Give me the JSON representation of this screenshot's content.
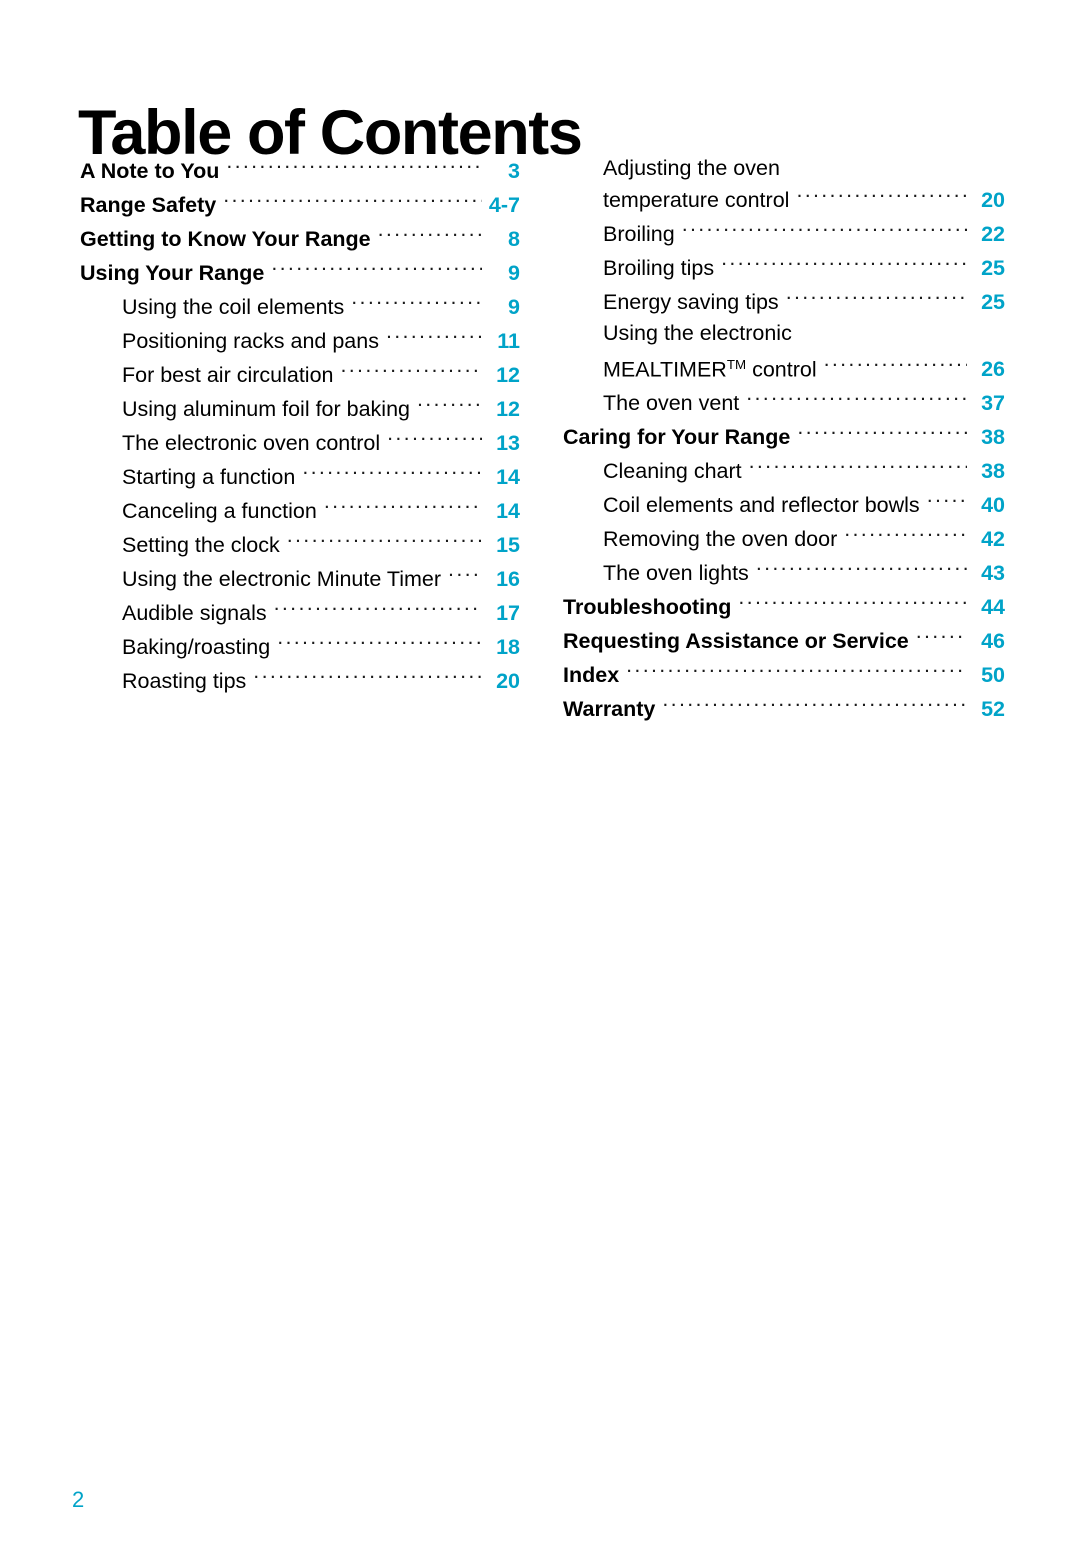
{
  "document": {
    "title": "Table of Contents",
    "folio": "2",
    "accent_color": "#00a3c8",
    "text_color": "#000000",
    "background_color": "#ffffff"
  },
  "toc": {
    "left_column": [
      {
        "label": "A Note to You",
        "page": "3",
        "level": 1
      },
      {
        "label": "Range Safety",
        "page": "4-7",
        "level": 1
      },
      {
        "label": "Getting to Know Your Range",
        "page": "8",
        "level": 1
      },
      {
        "label": "Using Your Range",
        "page": "9",
        "level": 1
      },
      {
        "label": "Using the coil elements",
        "page": "9",
        "level": 2
      },
      {
        "label": "Positioning racks and pans",
        "page": "11",
        "level": 2
      },
      {
        "label": "For best air circulation",
        "page": "12",
        "level": 2
      },
      {
        "label": "Using aluminum foil for baking",
        "page": "12",
        "level": 2
      },
      {
        "label": "The electronic oven control",
        "page": "13",
        "level": 2
      },
      {
        "label": "Starting a function",
        "page": "14",
        "level": 2
      },
      {
        "label": "Canceling a function",
        "page": "14",
        "level": 2
      },
      {
        "label": "Setting the clock",
        "page": "15",
        "level": 2
      },
      {
        "label": "Using the electronic Minute Timer",
        "page": "16",
        "level": 2
      },
      {
        "label": "Audible signals",
        "page": "17",
        "level": 2
      },
      {
        "label": "Baking/roasting",
        "page": "18",
        "level": 2
      },
      {
        "label": "Roasting tips",
        "page": "20",
        "level": 2
      }
    ],
    "right_column": [
      {
        "label_line1": "Adjusting the oven",
        "label": "temperature control",
        "page": "20",
        "level": 2,
        "wrapped": true
      },
      {
        "label": "Broiling",
        "page": "22",
        "level": 2
      },
      {
        "label": "Broiling tips",
        "page": "25",
        "level": 2
      },
      {
        "label": "Energy saving tips",
        "page": "25",
        "level": 2
      },
      {
        "label_line1": "Using the electronic",
        "label": "MEALTIMER",
        "label_suffix": " control",
        "trademark": "TM",
        "page": "26",
        "level": 2,
        "wrapped": true
      },
      {
        "label": "The oven vent",
        "page": "37",
        "level": 2
      },
      {
        "label": "Caring for Your Range",
        "page": "38",
        "level": 1
      },
      {
        "label": "Cleaning chart",
        "page": "38",
        "level": 2
      },
      {
        "label": "Coil elements and reflector bowls",
        "page": "40",
        "level": 2
      },
      {
        "label": "Removing the oven door",
        "page": "42",
        "level": 2
      },
      {
        "label": "The oven lights",
        "page": "43",
        "level": 2
      },
      {
        "label": "Troubleshooting",
        "page": "44",
        "level": 1
      },
      {
        "label": "Requesting Assistance or Service",
        "page": "46",
        "level": 1
      },
      {
        "label": "Index",
        "page": "50",
        "level": 1
      },
      {
        "label": "Warranty",
        "page": "52",
        "level": 1
      }
    ]
  }
}
